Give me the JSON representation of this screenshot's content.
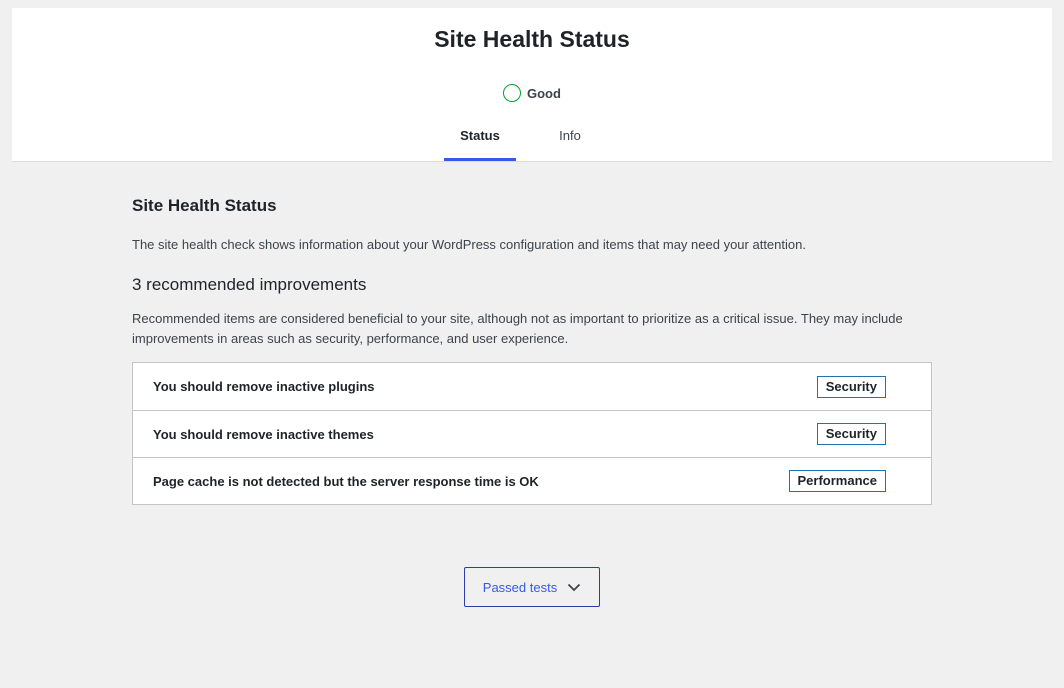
{
  "header": {
    "title": "Site Health Status",
    "status_label": "Good",
    "status_color": "#00a32a",
    "tabs": [
      {
        "label": "Status",
        "active": true
      },
      {
        "label": "Info",
        "active": false
      }
    ]
  },
  "main": {
    "heading": "Site Health Status",
    "intro": "The site health check shows information about your WordPress configuration and items that may need your attention.",
    "improvements_heading": "3 recommended improvements",
    "improvements_description": "Recommended items are considered beneficial to your site, although not as important to prioritize as a critical issue. They may include improvements in areas such as security, performance, and user experience.",
    "issues": [
      {
        "title": "You should remove inactive plugins",
        "badge": "Security"
      },
      {
        "title": "You should remove inactive themes",
        "badge": "Security"
      },
      {
        "title": "Page cache is not detected but the server response time is OK",
        "badge": "Performance"
      }
    ],
    "passed_tests_label": "Passed tests",
    "passed_tests_icon": "chevron-down-icon"
  },
  "colors": {
    "accent": "#3858e9",
    "badge_border": "#2271b1",
    "background": "#f0f0f1"
  }
}
